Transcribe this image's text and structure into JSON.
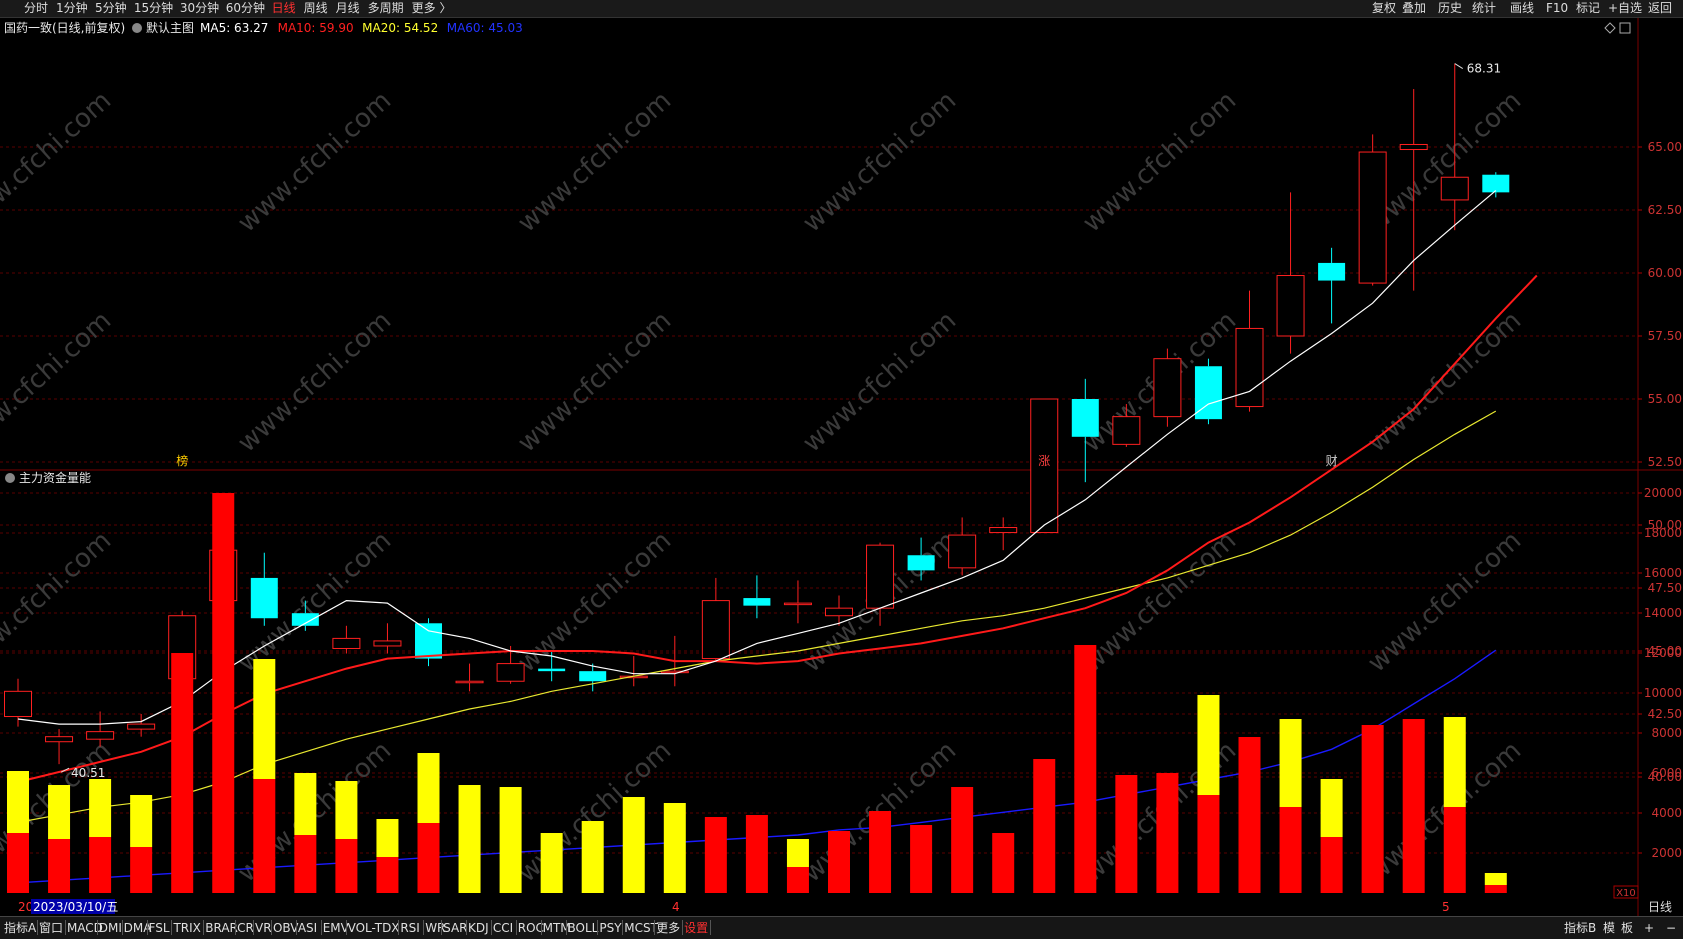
{
  "toolbar": {
    "period_tabs": [
      "分时",
      "1分钟",
      "5分钟",
      "15分钟",
      "30分钟",
      "60分钟",
      "日线",
      "周线",
      "月线",
      "多周期",
      "更多 〉"
    ],
    "active_period": "日线",
    "right_tools": [
      "复权",
      "叠加",
      "历史",
      "统计",
      "画线",
      "F10",
      "标记",
      "+自选",
      "返回"
    ]
  },
  "main_chart": {
    "stock_label": "国药一致(日线,前复权)",
    "indicator_label": "默认主图",
    "ma_labels": [
      {
        "text": "MA5: 63.27",
        "color": "#ffffff"
      },
      {
        "text": "MA10: 59.90",
        "color": "#ff2020"
      },
      {
        "text": "MA20: 54.52",
        "color": "#ffff30"
      },
      {
        "text": "MA60: 45.03",
        "color": "#2233ff"
      }
    ],
    "price_ticks": [
      "65.00",
      "62.50",
      "60.00",
      "57.50",
      "55.00",
      "52.50",
      "50.00",
      "47.50",
      "45.00",
      "42.50",
      "40.00"
    ],
    "high_marker": "68.31",
    "low_marker": "40.51",
    "event_markers": [
      {
        "text": "榜"
      },
      {
        "text": "涨"
      },
      {
        "text": "财"
      }
    ],
    "watermark": "www.cfchi.com"
  },
  "sub_chart": {
    "indicator_name": "主力资金量能",
    "axis_ticks": [
      "20000",
      "18000",
      "16000",
      "14000",
      "12000",
      "10000",
      "8000",
      "6000",
      "4000",
      "2000"
    ],
    "scale_label": "X10",
    "date_label": "2023/03/10/五",
    "month_markers": [
      "20",
      "4",
      "5"
    ],
    "period_label": "日线"
  },
  "bottom_tabs": [
    "指标A",
    "窗口",
    "MACD",
    "DMI",
    "DMA",
    "FSL",
    "TRIX",
    "BRAR",
    "CR",
    "VR",
    "OBV",
    "ASI",
    "EMV",
    "VOL-TDX",
    "RSI",
    "WR",
    "SAR",
    "KDJ",
    "CCI",
    "ROC",
    "MTM",
    "BOLL",
    "PSY",
    "MCST",
    "更多",
    "设置"
  ],
  "bottom_right": [
    "指标B",
    "模",
    "板",
    "+",
    "−"
  ],
  "colors": {
    "up": "#ff2020",
    "down": "#00ffff",
    "ma5": "#ffffff",
    "ma10": "#ff1a1a",
    "ma20": "#e8e830",
    "ma60": "#1a1aff",
    "grid": "#5a0000",
    "bar_red": "#ff0000",
    "bar_yellow": "#ffff00"
  },
  "chart_data": {
    "type": "candlestick",
    "candles": [
      {
        "o": 42.4,
        "c": 43.4,
        "h": 43.9,
        "l": 42.0
      },
      {
        "o": 41.4,
        "c": 41.6,
        "h": 41.9,
        "l": 40.51
      },
      {
        "o": 41.5,
        "c": 41.8,
        "h": 42.6,
        "l": 41.2
      },
      {
        "o": 41.9,
        "c": 42.1,
        "h": 42.5,
        "l": 41.6
      },
      {
        "o": 43.9,
        "c": 46.4,
        "h": 46.6,
        "l": 43.8
      },
      {
        "o": 47.0,
        "c": 49.0,
        "h": 49.9,
        "l": 46.9
      },
      {
        "o": 47.9,
        "c": 46.3,
        "h": 48.9,
        "l": 46.0
      },
      {
        "o": 46.5,
        "c": 46.0,
        "h": 47.0,
        "l": 45.8
      },
      {
        "o": 45.1,
        "c": 45.5,
        "h": 46.0,
        "l": 44.9
      },
      {
        "o": 45.2,
        "c": 45.4,
        "h": 46.1,
        "l": 44.9
      },
      {
        "o": 46.1,
        "c": 44.7,
        "h": 46.3,
        "l": 44.4
      },
      {
        "o": 43.8,
        "c": 43.8,
        "h": 44.5,
        "l": 43.4
      },
      {
        "o": 43.8,
        "c": 44.5,
        "h": 45.2,
        "l": 43.7
      },
      {
        "o": 44.3,
        "c": 44.2,
        "h": 45.0,
        "l": 43.8
      },
      {
        "o": 44.2,
        "c": 43.8,
        "h": 44.5,
        "l": 43.4
      },
      {
        "o": 44.0,
        "c": 44.0,
        "h": 44.8,
        "l": 43.6
      },
      {
        "o": 44.2,
        "c": 44.2,
        "h": 45.6,
        "l": 43.6
      },
      {
        "o": 44.7,
        "c": 47.0,
        "h": 47.9,
        "l": 44.6
      },
      {
        "o": 47.1,
        "c": 46.8,
        "h": 48.0,
        "l": 46.3
      },
      {
        "o": 46.9,
        "c": 46.9,
        "h": 47.8,
        "l": 46.1
      },
      {
        "o": 46.4,
        "c": 46.7,
        "h": 47.2,
        "l": 46.0
      },
      {
        "o": 46.7,
        "c": 49.2,
        "h": 49.3,
        "l": 46.0
      },
      {
        "o": 48.8,
        "c": 48.2,
        "h": 49.5,
        "l": 47.8
      },
      {
        "o": 48.3,
        "c": 49.6,
        "h": 50.3,
        "l": 48.0
      },
      {
        "o": 49.7,
        "c": 49.9,
        "h": 50.3,
        "l": 49.0
      },
      {
        "o": 49.7,
        "c": 55.0,
        "h": 55.0,
        "l": 49.7
      },
      {
        "o": 55.0,
        "c": 53.5,
        "h": 55.8,
        "l": 51.7
      },
      {
        "o": 53.2,
        "c": 54.3,
        "h": 54.8,
        "l": 53.1
      },
      {
        "o": 54.3,
        "c": 56.6,
        "h": 57.0,
        "l": 53.9
      },
      {
        "o": 56.3,
        "c": 54.2,
        "h": 56.6,
        "l": 54.0
      },
      {
        "o": 54.7,
        "c": 57.8,
        "h": 59.3,
        "l": 54.5
      },
      {
        "o": 57.5,
        "c": 59.9,
        "h": 63.2,
        "l": 56.8
      },
      {
        "o": 60.4,
        "c": 59.7,
        "h": 61.0,
        "l": 58.0
      },
      {
        "o": 59.6,
        "c": 64.8,
        "h": 65.5,
        "l": 59.5
      },
      {
        "o": 64.9,
        "c": 65.1,
        "h": 67.3,
        "l": 59.3
      },
      {
        "o": 62.9,
        "c": 63.8,
        "h": 68.31,
        "l": 61.7
      },
      {
        "o": 63.9,
        "c": 63.2,
        "h": 64.0,
        "l": 63.0
      }
    ],
    "ma5": [
      42.3,
      42.1,
      42.1,
      42.2,
      43.0,
      44.2,
      45.2,
      46.1,
      47.0,
      46.9,
      45.8,
      45.5,
      45.0,
      44.8,
      44.4,
      44.1,
      44.1,
      44.6,
      45.3,
      45.7,
      46.1,
      46.7,
      47.3,
      47.9,
      48.6,
      50.0,
      51.0,
      52.3,
      53.6,
      54.8,
      55.3,
      56.5,
      57.6,
      58.8,
      60.5,
      61.9,
      63.27
    ],
    "ma10": [
      39.8,
      40.2,
      40.6,
      41.0,
      41.6,
      42.5,
      43.3,
      43.8,
      44.3,
      44.7,
      44.8,
      44.9,
      45.0,
      45.0,
      45.0,
      44.9,
      44.6,
      44.6,
      44.5,
      44.6,
      44.9,
      45.1,
      45.3,
      45.6,
      45.9,
      46.3,
      46.7,
      47.3,
      48.2,
      49.3,
      50.1,
      51.1,
      52.2,
      53.3,
      54.6,
      56.4,
      58.2,
      59.9
    ],
    "ma20": [
      38.2,
      38.5,
      38.8,
      39.0,
      39.3,
      39.8,
      40.5,
      41.0,
      41.5,
      41.9,
      42.3,
      42.7,
      43.0,
      43.4,
      43.7,
      44.0,
      44.3,
      44.6,
      44.8,
      45.0,
      45.3,
      45.6,
      45.9,
      46.2,
      46.4,
      46.7,
      47.1,
      47.5,
      47.9,
      48.4,
      48.9,
      49.6,
      50.5,
      51.5,
      52.6,
      53.6,
      54.52
    ],
    "ma60": [
      35.8,
      35.9,
      36.0,
      36.1,
      36.2,
      36.3,
      36.4,
      36.5,
      36.6,
      36.7,
      36.8,
      36.9,
      37.0,
      37.1,
      37.2,
      37.3,
      37.4,
      37.5,
      37.6,
      37.7,
      37.9,
      38.0,
      38.2,
      38.4,
      38.6,
      38.8,
      39.0,
      39.3,
      39.6,
      39.9,
      40.2,
      40.6,
      41.1,
      41.9,
      42.9,
      43.9,
      45.03
    ],
    "fund_volume": {
      "red": [
        3000,
        2700,
        2800,
        2300,
        12000,
        20000,
        5700,
        2900,
        2700,
        1800,
        3500,
        0,
        0,
        0,
        0,
        0,
        0,
        3800,
        3900,
        1300,
        3100,
        4100,
        3400,
        5300,
        3000,
        6700,
        12400,
        5900,
        6000,
        4900,
        7800,
        4300,
        2800,
        8400,
        8700,
        4300,
        400
      ],
      "yellow": [
        6100,
        5400,
        5700,
        4900,
        0,
        0,
        11700,
        6000,
        5600,
        3700,
        7000,
        5400,
        5300,
        3000,
        3600,
        4800,
        4500,
        0,
        0,
        2700,
        1500,
        0,
        0,
        0,
        0,
        0,
        0,
        0,
        0,
        9900,
        0,
        8700,
        5700,
        0,
        0,
        8800,
        1000
      ]
    }
  }
}
